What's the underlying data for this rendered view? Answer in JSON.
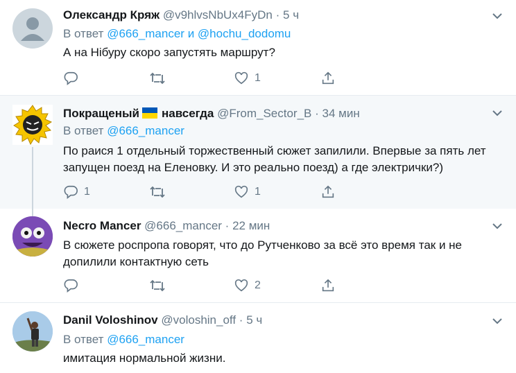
{
  "tweets": [
    {
      "name": "Олександр Кряж",
      "handle": "@v9hlvsNbUx4FyDn",
      "separator": "·",
      "time": "5 ч",
      "reply_prefix": "В ответ",
      "mentions": [
        "@666_mancer",
        "@hochu_dodomu"
      ],
      "mention_joiner": "и",
      "text": "А на Нібуру скоро запустять маршрут?",
      "replies": "",
      "retweets": "",
      "likes": "1"
    },
    {
      "name": "Покращеный",
      "name_suffix": "навсегда",
      "handle": "@From_Sector_B",
      "separator": "·",
      "time": "34 мин",
      "reply_prefix": "В ответ",
      "mentions": [
        "@666_mancer"
      ],
      "text": "По раися 1 отдельный торжественный сюжет запилили. Впервые за пять лет запущен поезд на Еленовку. И это реально поезд) а где электрички?)",
      "replies": "1",
      "retweets": "",
      "likes": "1"
    },
    {
      "name": "Necro Mancer",
      "handle": "@666_mancer",
      "separator": "·",
      "time": "22 мин",
      "text": "В сюжете роспропа говорят, что до Рутченково за всё это время так и не допилили контактную сеть",
      "replies": "",
      "retweets": "",
      "likes": "2"
    },
    {
      "name": "Danil Voloshinov",
      "handle": "@voloshin_off",
      "separator": "·",
      "time": "5 ч",
      "reply_prefix": "В ответ",
      "mentions": [
        "@666_mancer"
      ],
      "text": "имитация нормальной жизни."
    }
  ],
  "colors": {
    "accent": "#1da1f2",
    "muted": "#657786",
    "highlight_bg": "#f5f8fa",
    "divider": "#e6ecf0",
    "flag_blue": "#0057b7",
    "flag_yellow": "#ffd700"
  },
  "icons": [
    "chevron-down-icon",
    "reply-icon",
    "retweet-icon",
    "like-icon",
    "share-icon",
    "default-avatar-icon",
    "ukraine-flag-icon"
  ]
}
